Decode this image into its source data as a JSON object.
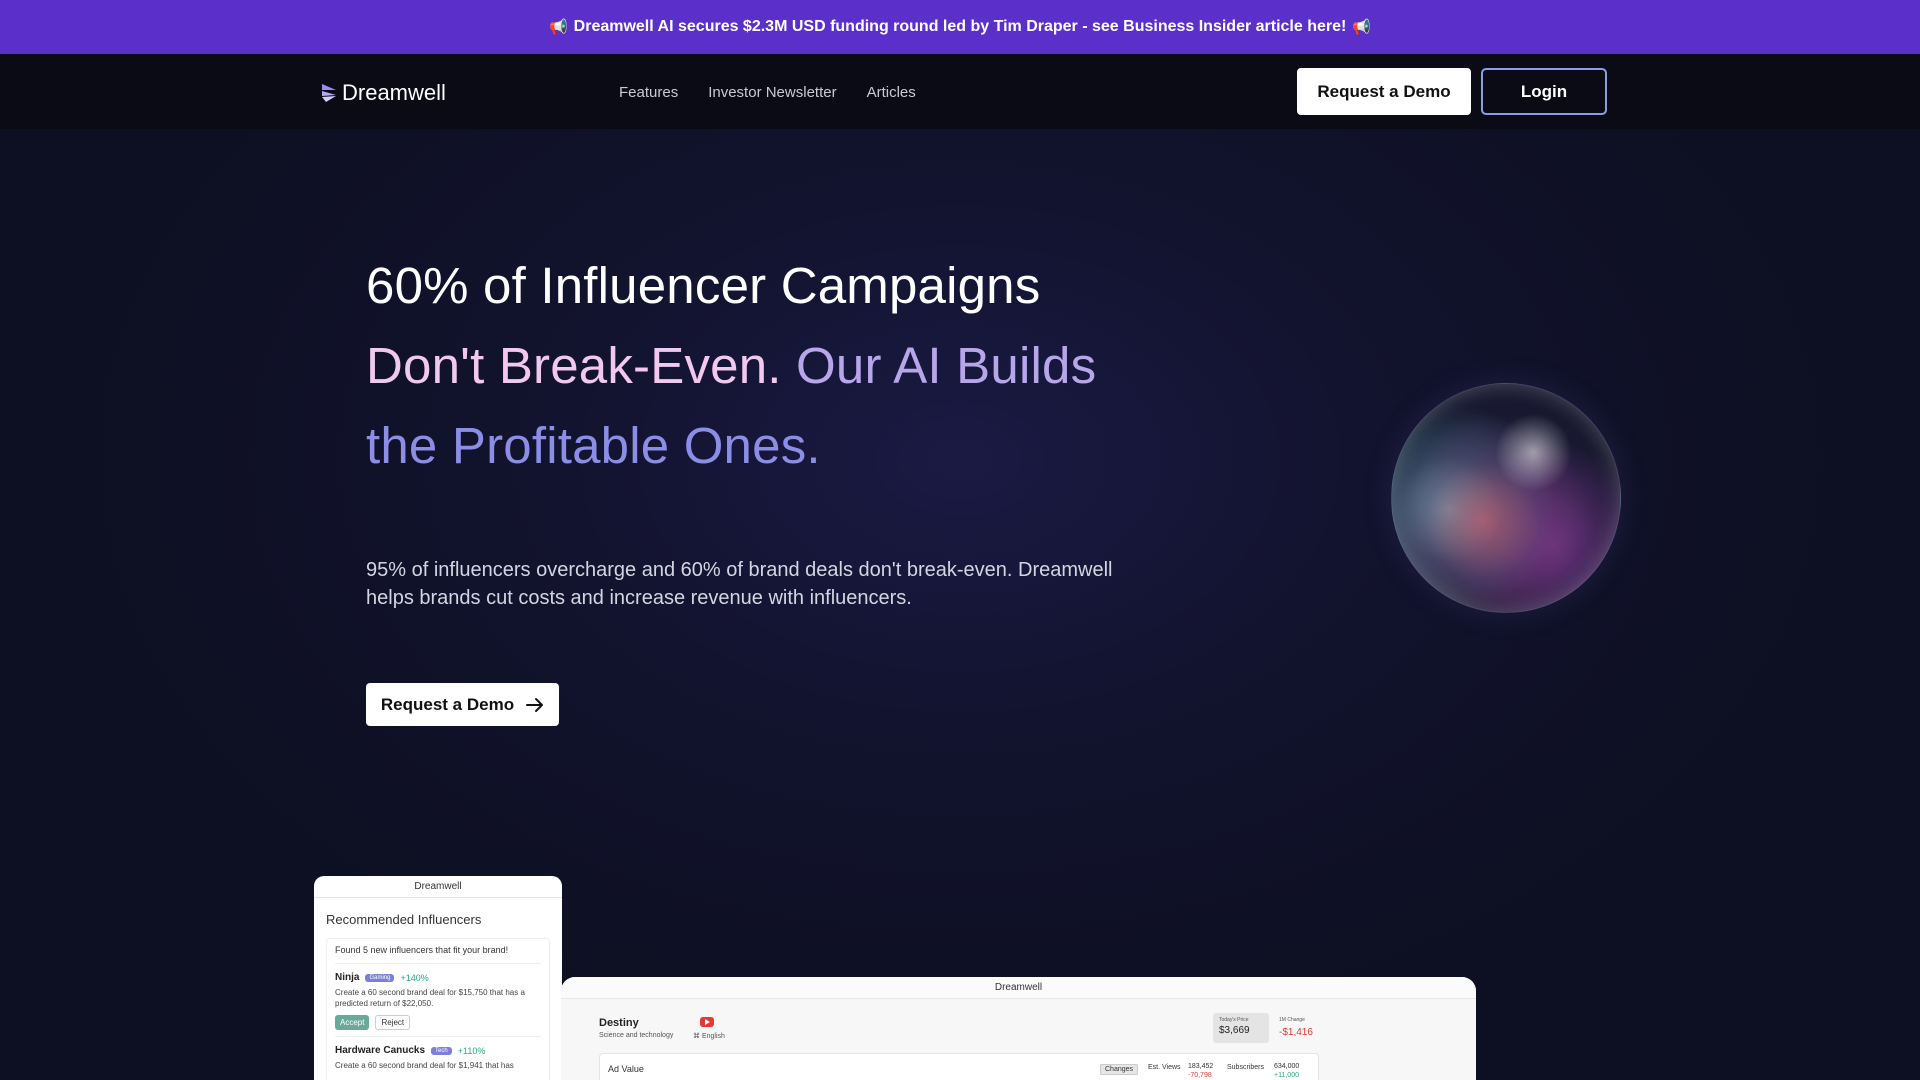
{
  "announcement": {
    "text": "Dreamwell AI secures $2.3M USD funding round led by Tim Draper - see Business Insider article here!",
    "icon": "megaphone-icon"
  },
  "nav": {
    "logo_text": "Dreamwell",
    "links": [
      "Features",
      "Investor Newsletter",
      "Articles"
    ],
    "request_demo": "Request a Demo",
    "login": "Login"
  },
  "hero": {
    "headline_line1": "60% of Influencer Campaigns",
    "headline_line2a": "Don't Break-Even.",
    "headline_line2b": " Our AI Builds",
    "headline_line3": "the Profitable Ones.",
    "subtext": "95% of influencers overcharge and 60% of brand deals don't break-even. Dreamwell helps brands cut costs and increase revenue with influencers.",
    "cta": "Request a Demo"
  },
  "phone": {
    "title": "Dreamwell",
    "heading": "Recommended Influencers",
    "found": "Found 5 new influencers that fit your brand!",
    "influencers": [
      {
        "name": "Ninja",
        "tag": "Gaming",
        "pct": "+140%",
        "desc": "Create a 60 second brand deal for $15,750 that has a predicted return of $22,050."
      },
      {
        "name": "Hardware Canucks",
        "tag": "Tech",
        "pct": "+110%",
        "desc": "Create a 60 second brand deal for $1,941 that has"
      }
    ],
    "accept": "Accept",
    "reject": "Reject"
  },
  "dashboard": {
    "title": "Dreamwell",
    "channel": "Destiny",
    "category": "Science and technology",
    "language": "English",
    "price_label": "Today's Price",
    "price_value": "$3,669",
    "change_label": "1M Change",
    "change_value": "-$1,416",
    "ad_value_label": "Ad Value",
    "changes_button": "Changes",
    "est_views_label": "Est. Views",
    "est_views_value": "183,452",
    "est_views_change": "-70,798",
    "subscribers_label": "Subscribers",
    "subscribers_value": "634,000",
    "subscribers_change": "+11,000"
  },
  "colors": {
    "announce_bg": "#5b2fc9",
    "nav_bg": "#0a0b14",
    "page_bg": "#0d0f22",
    "headline_pink": "#f2c9ee",
    "headline_lavender": "#b8a6ea",
    "headline_indigo": "#8c8ee6"
  }
}
